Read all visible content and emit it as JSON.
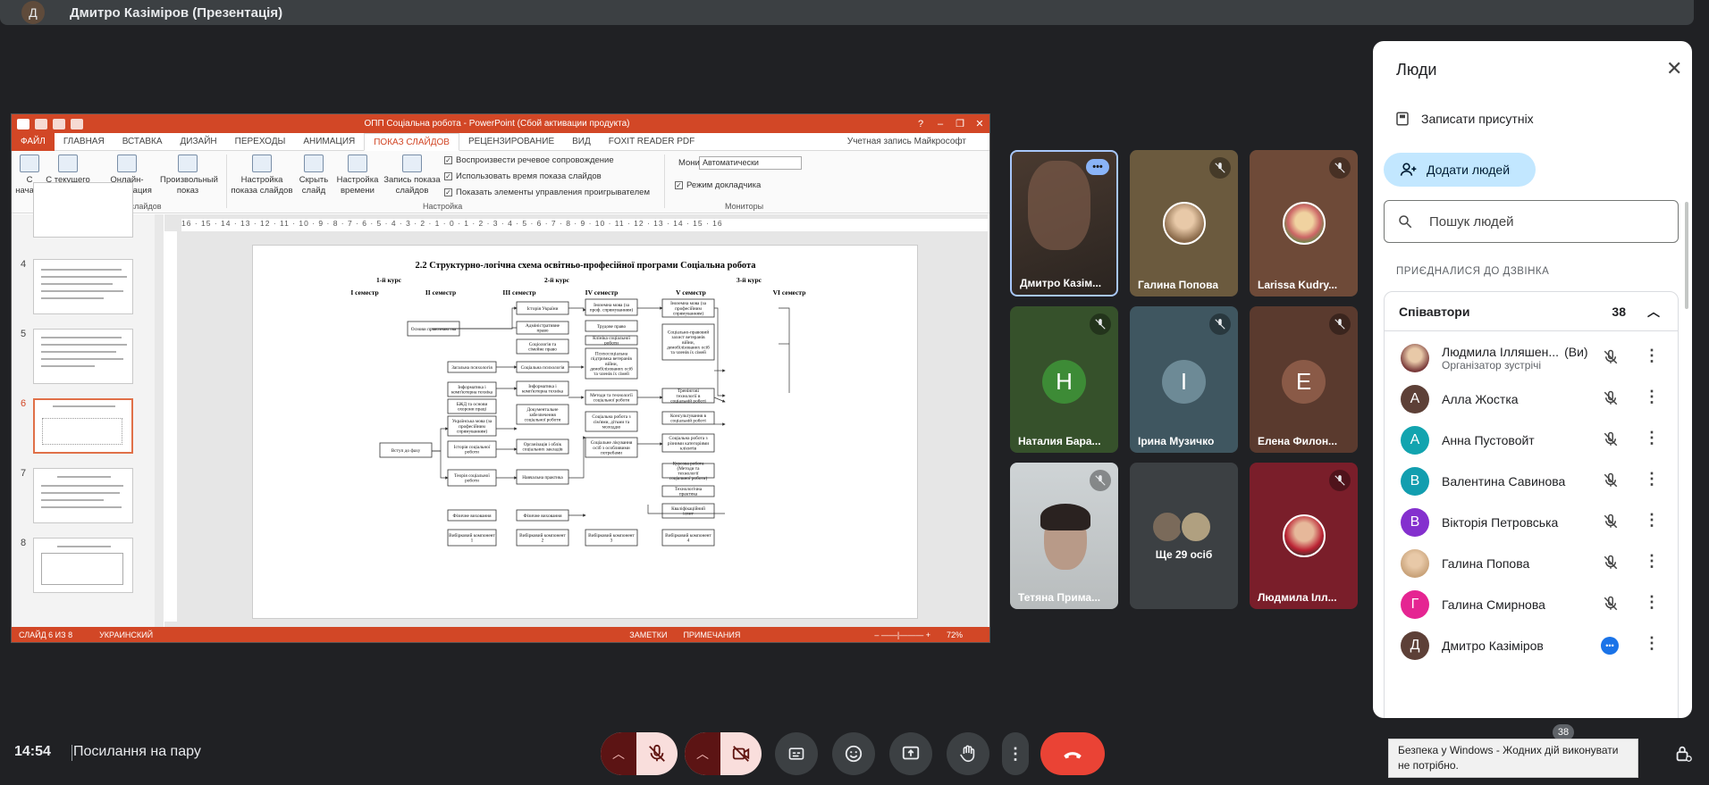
{
  "presenter": {
    "initial": "Д",
    "title": "Дмитро Казіміров (Презентація)"
  },
  "powerpoint": {
    "window_title": "ОПП Соціальна робота -  PowerPoint (Сбой активации продукта)",
    "tabs": [
      "ФАЙЛ",
      "ГЛАВНАЯ",
      "ВСТАВКА",
      "ДИЗАЙН",
      "ПЕРЕХОДЫ",
      "АНИМАЦИЯ",
      "ПОКАЗ СЛАЙДОВ",
      "РЕЦЕНЗИРОВАНИЕ",
      "ВИД",
      "FOXIT READER PDF"
    ],
    "account": "Учетная запись Майкрософт",
    "ribbon": {
      "from_start": "С начала",
      "from_current": "С текущего слайда",
      "online": "Онлайн-презентация",
      "custom": "Произвольный показ",
      "setup": "Настройка показа слайдов",
      "hide": "Скрыть слайд",
      "rehearse": "Настройка времени",
      "record": "Запись показа слайдов",
      "chk_narration": "Воспроизвести речевое сопровождение",
      "chk_timings": "Использовать время показа слайдов",
      "chk_controls": "Показать элементы управления проигрывателем",
      "monitor_label": "Монитор:",
      "monitor_value": "Автоматически",
      "presenter_view": "Режим докладчика",
      "group_start": "Начать показ слайдов",
      "group_setup": "Настройка",
      "group_monitors": "Мониторы"
    },
    "thumb_numbers": [
      "4",
      "5",
      "6",
      "7",
      "8"
    ],
    "ruler_text": "16 · 15 · 14 · 13 · 12 · 11 · 10 · 9 · 8 · 7 · 6 · 5 · 4 · 3 · 2 · 1 · 0 · 1 · 2 · 3 · 4 · 5 · 6 · 7 · 8 · 9 · 10 · 11 · 12 · 13 · 14 · 15 · 16",
    "status": {
      "slide": "СЛАЙД 6 ИЗ 8",
      "language": "УКРАИНСКИЙ",
      "notes": "ЗАМЕТКИ",
      "comments": "ПРИМЕЧАНИЯ",
      "zoom": "72%"
    }
  },
  "slide": {
    "title": "2.2 Структурно-логічна схема освітньо-професійної програми Соціальна робота",
    "courses": [
      "1-й курс",
      "2-й курс",
      "3-й курс"
    ],
    "semesters": [
      "І семестр",
      "ІІ семестр",
      "ІІІ семестр",
      "ІV семестр",
      "V семестр",
      "VІ семестр"
    ],
    "boxes": {
      "osnovy": "Основи правознавства",
      "vstup": "Вступ до фаху",
      "zag_psyh": "Загальна психологія",
      "inform1": "Інформатика і комп'ютерна техніка",
      "bzd": "БЖД та основи охорони праці",
      "ukr1": "Українська мова (за професійним спрямуванням)",
      "istoriya_sr": "Історія соціальної роботи",
      "teoriya": "Теорія соціальної роботи",
      "ist_ukr": "Історія України",
      "admin": "Адміністративне право",
      "social_sim": "Соціологія та сімейне право",
      "soc_psyh": "Соціальна психологія",
      "inform2": "Інформатика і комп'ютерна техніка",
      "dokum": "Документальне забезпечення соціальної роботи",
      "organ": "Організація і облік соціальних закладів",
      "navch": "Навчальна практика",
      "ukr2": "Іноземна мова (за проф. спрямуванням)",
      "trud": "Трудове право",
      "klin": "Клініка соціальної роботи",
      "psychosoc": "Психосоціальна підтримка ветеранів війни, демобілізованих осіб та членів їх сімей",
      "metody": "Методи та технології соціальної роботи",
      "sr_simya": "Соціальна робота з сім'ями, дітьми та молоддю",
      "soc_zahyst": "Соціальне лікування осіб з особливими потребами",
      "inozem3": "Іноземна мова (за професійним спрямуванням)",
      "soc_prav": "Соціально-правовий захист ветеранів війни, демобілізованих осіб та членів їх сімей",
      "trening": "Тренінгові технології в соціальній роботі",
      "konsult": "Консультування в соціальній роботі",
      "sr_riz": "Соціальна робота з різними категоріями клієнтів",
      "kursova": "Курсова робота (Методи та технології соціальної роботи)",
      "tech_pr": "Технологічна практика",
      "kval": "Кваліфікаційний іспит",
      "fiz1": "Фізичне виховання",
      "fiz2": "Фізичне виховання",
      "vyb1": "Вибірковий компонент 1",
      "vyb2": "Вибірковий компонент 2",
      "vyb3": "Вибірковий компонент 3",
      "vyb4": "Вибірковий компонент 4"
    }
  },
  "tiles": [
    {
      "name": "Дмитро Казім...",
      "type": "video"
    },
    {
      "name": "Галина Попова",
      "type": "photo"
    },
    {
      "name": "Larissa Kudry...",
      "type": "photo"
    },
    {
      "name": "Наталия Бара...",
      "letter": "Н",
      "color": "#3d8b36"
    },
    {
      "name": "Ірина Музичко",
      "letter": "І",
      "color": "#6d8a96"
    },
    {
      "name": "Елена Филон...",
      "letter": "E",
      "color": "#8a5a47"
    },
    {
      "name": "Тетяна Прима...",
      "type": "video"
    },
    {
      "name": "Ще 29 осіб",
      "type": "more"
    },
    {
      "name": "Людмила Ілл...",
      "type": "photo"
    }
  ],
  "people_panel": {
    "title": "Люди",
    "record_attendance": "Записати присутніх",
    "add_people": "Додати людей",
    "search_placeholder": "Пошук людей",
    "joined_label": "ПРИЄДНАЛИСЯ ДО ДЗВІНКА",
    "cohosts_label": "Співавтори",
    "cohosts_count": "38",
    "people": [
      {
        "name": "Людмила Ілляшен...",
        "you": "(Ви)",
        "sub": "Організатор зустрічі",
        "initial": "",
        "color": "#7a3b3b"
      },
      {
        "name": "Алла Жостка",
        "initial": "А",
        "color": "#5d4037"
      },
      {
        "name": "Анна Пустовойт",
        "initial": "А",
        "color": "#12a4af"
      },
      {
        "name": "Валентина Савинова",
        "initial": "В",
        "color": "#129eaf"
      },
      {
        "name": "Вікторія Петровська",
        "initial": "В",
        "color": "#8430ce"
      },
      {
        "name": "Галина Попова",
        "initial": "",
        "color": "#c9a37a"
      },
      {
        "name": "Галина Смирнова",
        "initial": "Г",
        "color": "#e52592"
      },
      {
        "name": "Дмитро Казіміров",
        "initial": "Д",
        "color": "#5d4037"
      }
    ]
  },
  "bottom": {
    "time": "14:54",
    "meeting_name": "Посилання на пару",
    "participants_badge": "38",
    "toast": "Безпека у Windows - Жодних дій виконувати не потрібно."
  },
  "colors": {
    "end_call": "#ea4335",
    "mic_off_bg": "#f9dedc",
    "accent": "#1a73e8",
    "ppt_red": "#d24726"
  }
}
